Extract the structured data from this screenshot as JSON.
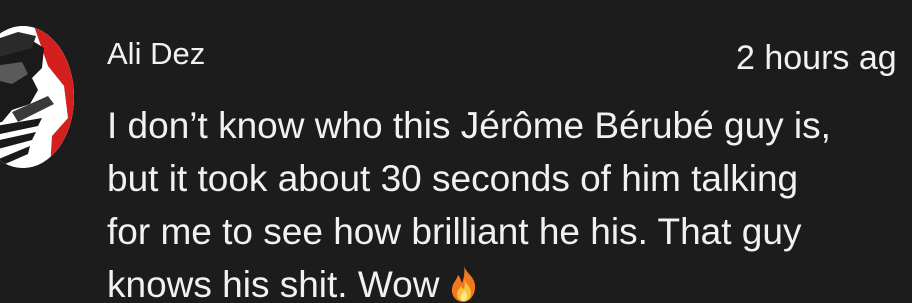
{
  "comment": {
    "author": "Ali Dez",
    "timestamp": "2 hours ag",
    "lines": [
      "I don’t know who this Jérôme Bérubé guy is,",
      "but it took about 30 seconds of him talking",
      "for me to see how brilliant he his. That guy",
      "knows his shit. Wow"
    ],
    "emoji": "fire-emoji"
  },
  "colors": {
    "background": "#1c1c1c",
    "text": "#f1f1f1",
    "avatar_accent": "#d3201e"
  }
}
